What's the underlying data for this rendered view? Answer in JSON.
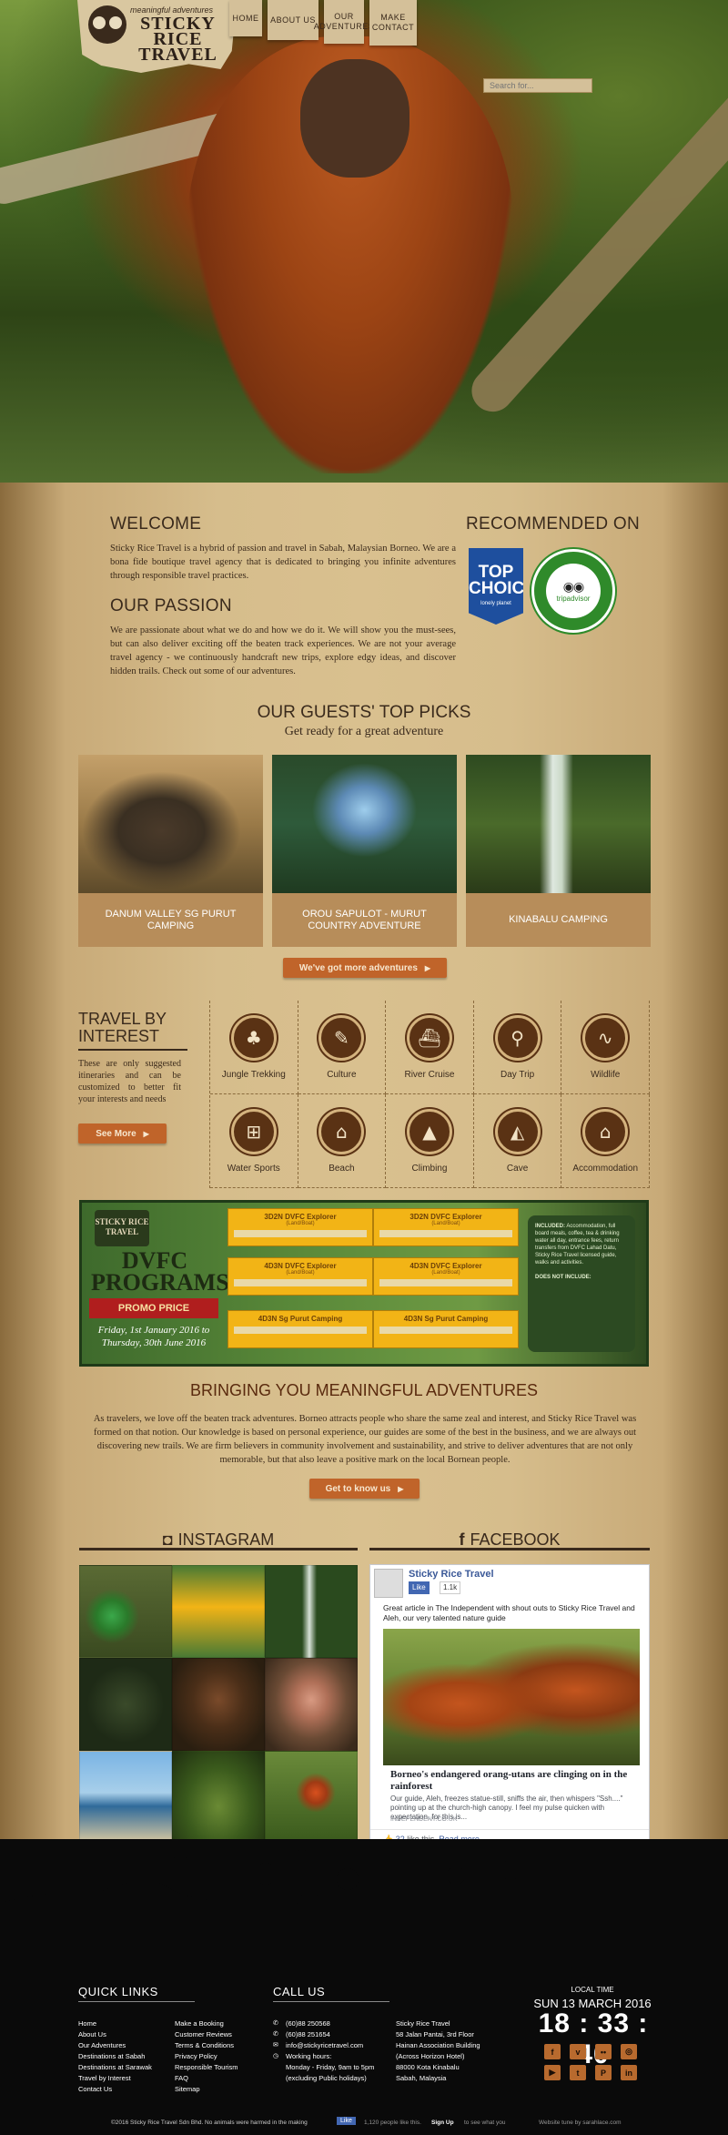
{
  "brand": {
    "tagline": "meaningful adventures",
    "name": "STICKY RICE TRAVEL"
  },
  "nav": [
    "HOME",
    "ABOUT US",
    "OUR ADVENTURES",
    "MAKE CONTACT"
  ],
  "search": {
    "placeholder": "Search for..."
  },
  "welcome": {
    "title": "WELCOME",
    "text": "Sticky Rice Travel is a hybrid of passion and travel in Sabah, Malaysian Borneo. We are a bona fide boutique travel agency that is dedicated to bringing you infinite adventures through responsible travel practices."
  },
  "passion": {
    "title": "OUR PASSION",
    "text": "We are passionate about what we do and how we do it. We will show you the must-sees, but can also deliver exciting off the beaten track experiences. We are not your average travel agency - we continuously handcraft new trips, explore edgy ideas, and discover hidden trails. Check out some of our adventures."
  },
  "recommended": {
    "title": "RECOMMENDED ON",
    "top_choice": "TOP CHOICE",
    "lonely_planet": "lonely planet",
    "tripadvisor_ring": "RECOMMENDED ON TRIPADVISOR",
    "tripadvisor_name": "tripadvisor"
  },
  "picks": {
    "title": "OUR GUESTS' TOP PICKS",
    "subtitle": "Get ready for a great adventure",
    "items": [
      {
        "label": "DANUM VALLEY SG PURUT CAMPING"
      },
      {
        "label": "OROU SAPULOT - MURUT COUNTRY ADVENTURE"
      },
      {
        "label": "KINABALU CAMPING"
      }
    ],
    "more_button": "We've got more adventures"
  },
  "interest": {
    "title": "TRAVEL BY INTEREST",
    "description": "These are only suggested itineraries and can be customized to better fit your interests and needs",
    "button": "See More",
    "items": [
      {
        "label": "Jungle Trekking",
        "icon": "♣"
      },
      {
        "label": "Culture",
        "icon": "✎"
      },
      {
        "label": "River Cruise",
        "icon": "⛴"
      },
      {
        "label": "Day Trip",
        "icon": "⚲"
      },
      {
        "label": "Wildlife",
        "icon": "∿"
      },
      {
        "label": "Water Sports",
        "icon": "⊞"
      },
      {
        "label": "Beach",
        "icon": "⌂"
      },
      {
        "label": "Climbing",
        "icon": "▲"
      },
      {
        "label": "Cave",
        "icon": "◭"
      },
      {
        "label": "Accommodation",
        "icon": "⌂"
      }
    ]
  },
  "promo": {
    "logo": "STICKY RICE TRAVEL",
    "title": "DVFC PROGRAMS",
    "badge": "PROMO PRICE",
    "dates": "Friday, 1st January 2016 to Thursday, 30th June 2016",
    "packages": [
      {
        "name": "3D2N DVFC Explorer",
        "sub": "(Land/Boat)"
      },
      {
        "name": "3D2N DVFC Explorer",
        "sub": "(Land/Boat)"
      },
      {
        "name": "4D3N DVFC Explorer",
        "sub": "(Land/Boat)"
      },
      {
        "name": "4D3N DVFC Explorer",
        "sub": "(Land/Boat)"
      },
      {
        "name": "4D3N Sg Purut Camping",
        "sub": ""
      },
      {
        "name": "4D3N Sg Purut Camping",
        "sub": ""
      }
    ],
    "includes_title": "INCLUDED:",
    "includes": "Accommodation, full board meals, coffee, tea & drinking water all day, entrance fees, return transfers from DVFC Lahad Datu, Sticky Rice Travel licensed guide, walks and activities.",
    "not_included_title": "DOES NOT INCLUDE:"
  },
  "meaningful": {
    "title": "BRINGING YOU MEANINGFUL ADVENTURES",
    "text": "As travelers, we love off the beaten track adventures. Borneo attracts people who share the same zeal and interest, and Sticky Rice Travel was formed on that notion. Our knowledge is based on personal experience, our guides are some of the best in the business, and we are always out discovering new trails. We are firm believers in community involvement and sustainability, and strive to deliver adventures that are not only memorable, but that also leave a positive mark on the local Bornean people.",
    "button": "Get to know us"
  },
  "instagram": {
    "title": "INSTAGRAM"
  },
  "facebook": {
    "title": "FACEBOOK",
    "page_name": "Sticky Rice Travel",
    "like_label": "Like",
    "like_count": "1.1k",
    "post_text": "Great article in The Independent with shout outs to Sticky Rice Travel and Aleh, our very talented nature guide",
    "headline": "Borneo's endangered orang-utans are clinging on in the rainforest",
    "snippet": "Our guide, Aleh, freezes statue-still, sniffs the air, then whispers \"Ssh....\" pointing up at the church-high canopy. I feel my pulse quicken with expectation, for this is...",
    "source": "INDEPENDENT.CO.UK",
    "likes_count": "32",
    "likes_suffix": "like this.",
    "read_more": "Read more"
  },
  "footer": {
    "quick_links_title": "QUICK LINKS",
    "links_col1": [
      "Home",
      "About Us",
      "Our Adventures",
      "Destinations at Sabah",
      "Destinations at Sarawak",
      "Travel by Interest",
      "Contact Us"
    ],
    "links_col2": [
      "Make a Booking",
      "Customer Reviews",
      "Terms & Conditions",
      "Privacy Policy",
      "Responsible Tourism",
      "FAQ",
      "Sitemap"
    ],
    "call_title": "CALL US",
    "phone1": "(60)88 250568",
    "phone2": "(60)88 251654",
    "email": "info@stickyricetravel.com",
    "hours_label": "Working hours:",
    "hours": "Monday - Friday, 9am to 5pm",
    "hours_note": "(excluding Public holidays)",
    "address": [
      "Sticky Rice Travel",
      "58 Jalan Pantai, 3rd Floor",
      "Hainan Association Building",
      "(Across Horizon Hotel)",
      "88000 Kota Kinabalu",
      "Sabah, Malaysia"
    ],
    "local_time_label": "LOCAL TIME",
    "date": "SUN 13 MARCH 2016",
    "time": "18 : 33 : 40",
    "social": [
      "f",
      "v",
      "••",
      "◎",
      "▶",
      "t",
      "P",
      "in"
    ],
    "copyright": "©2016 Sticky Rice Travel Sdn Bhd. No animals were harmed in the making",
    "fb_like": "Like",
    "fb_text": "1,120 people like this.",
    "signup": "Sign Up",
    "signup_suffix": "to see what you",
    "credit": "Website tune by sarahlace.com"
  }
}
